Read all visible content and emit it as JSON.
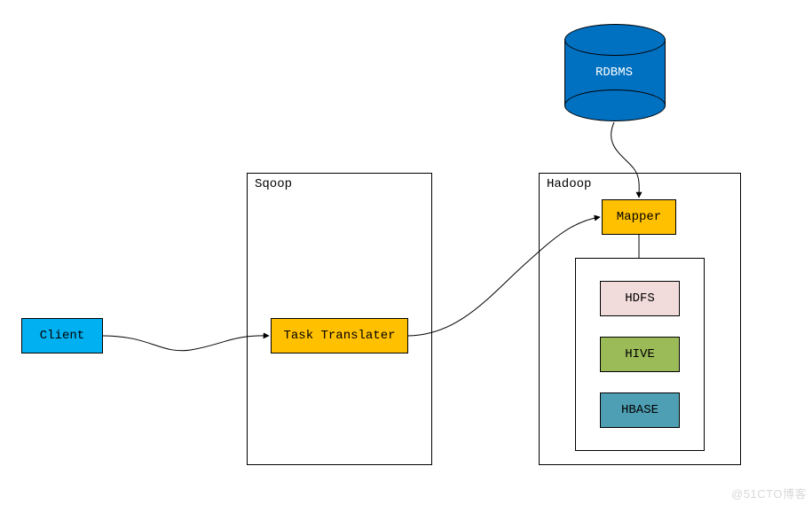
{
  "nodes": {
    "client": "Client",
    "task_translater": "Task Translater",
    "mapper": "Mapper",
    "hdfs": "HDFS",
    "hive": "HIVE",
    "hbase": "HBASE",
    "rdbms": "RDBMS"
  },
  "containers": {
    "sqoop": "Sqoop",
    "hadoop": "Hadoop"
  },
  "watermark": "@51CTO博客"
}
